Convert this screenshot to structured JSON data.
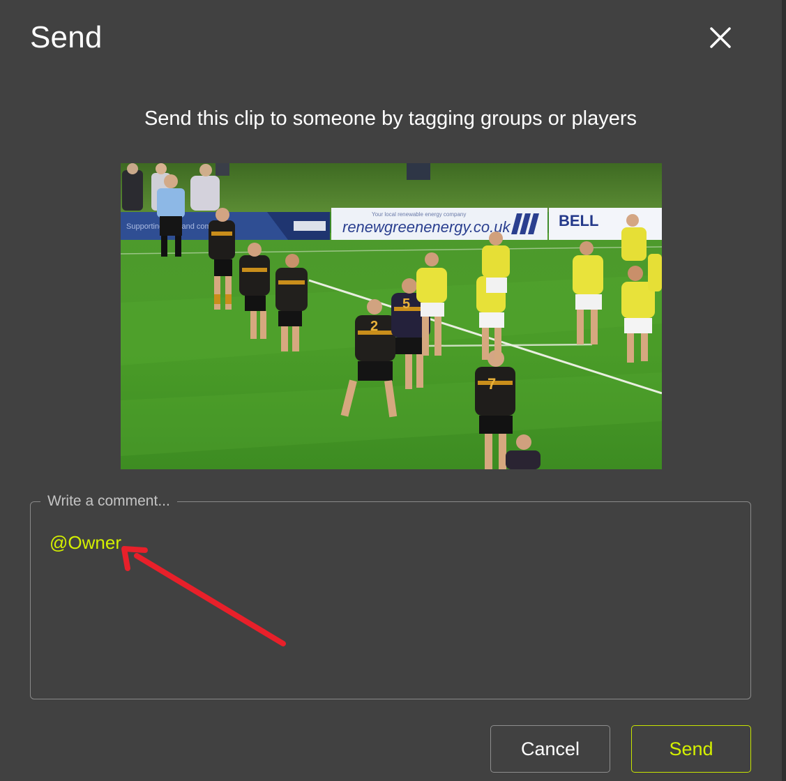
{
  "dialog": {
    "title": "Send",
    "close_icon": "close-icon",
    "subtitle": "Send this clip to someone by tagging groups or players"
  },
  "clip": {
    "banners": {
      "left": "Supporting club and community",
      "middle_small": "Your local renewable energy company",
      "middle": "renewgreenenergy.co.uk",
      "right": "BELL"
    },
    "jersey_numbers": [
      "2",
      "5",
      "7"
    ]
  },
  "comment": {
    "legend": "Write a comment...",
    "value": "@Owner"
  },
  "annotation": {
    "arrow_color": "#e8202a"
  },
  "buttons": {
    "cancel_label": "Cancel",
    "send_label": "Send"
  },
  "colors": {
    "background": "#414141",
    "accent": "#d4f000",
    "text": "#ffffff"
  }
}
